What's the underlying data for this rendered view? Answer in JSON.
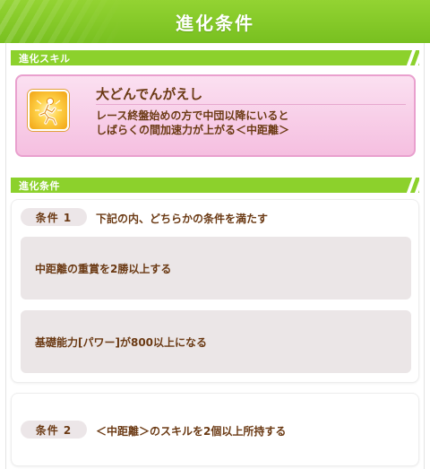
{
  "header": {
    "title": "進化条件"
  },
  "skill_section": {
    "label": "進化スキル"
  },
  "skill": {
    "name": "大どんでんがえし",
    "description_line1": "レース終盤始めの方で中団以降にいると",
    "description_line2": "しばらくの間加速力が上がる＜中距離＞",
    "icon": "running-figure-icon"
  },
  "conditions_section": {
    "label": "進化条件"
  },
  "conditions": [
    {
      "badge": "条件 1",
      "text": "下記の内、どちらかの条件を満たす",
      "sub_items": [
        "中距離の重賞を2勝以上する",
        "基礎能力[パワー]が800以上になる"
      ]
    },
    {
      "badge": "条件 2",
      "text": "＜中距離＞のスキルを2個以上所持する"
    }
  ],
  "colors": {
    "accent_green": "#8cd12c",
    "skill_card_pink": "#f5bfe0",
    "text_brown": "#6b3a14",
    "pill_grey": "#ece6e8"
  }
}
